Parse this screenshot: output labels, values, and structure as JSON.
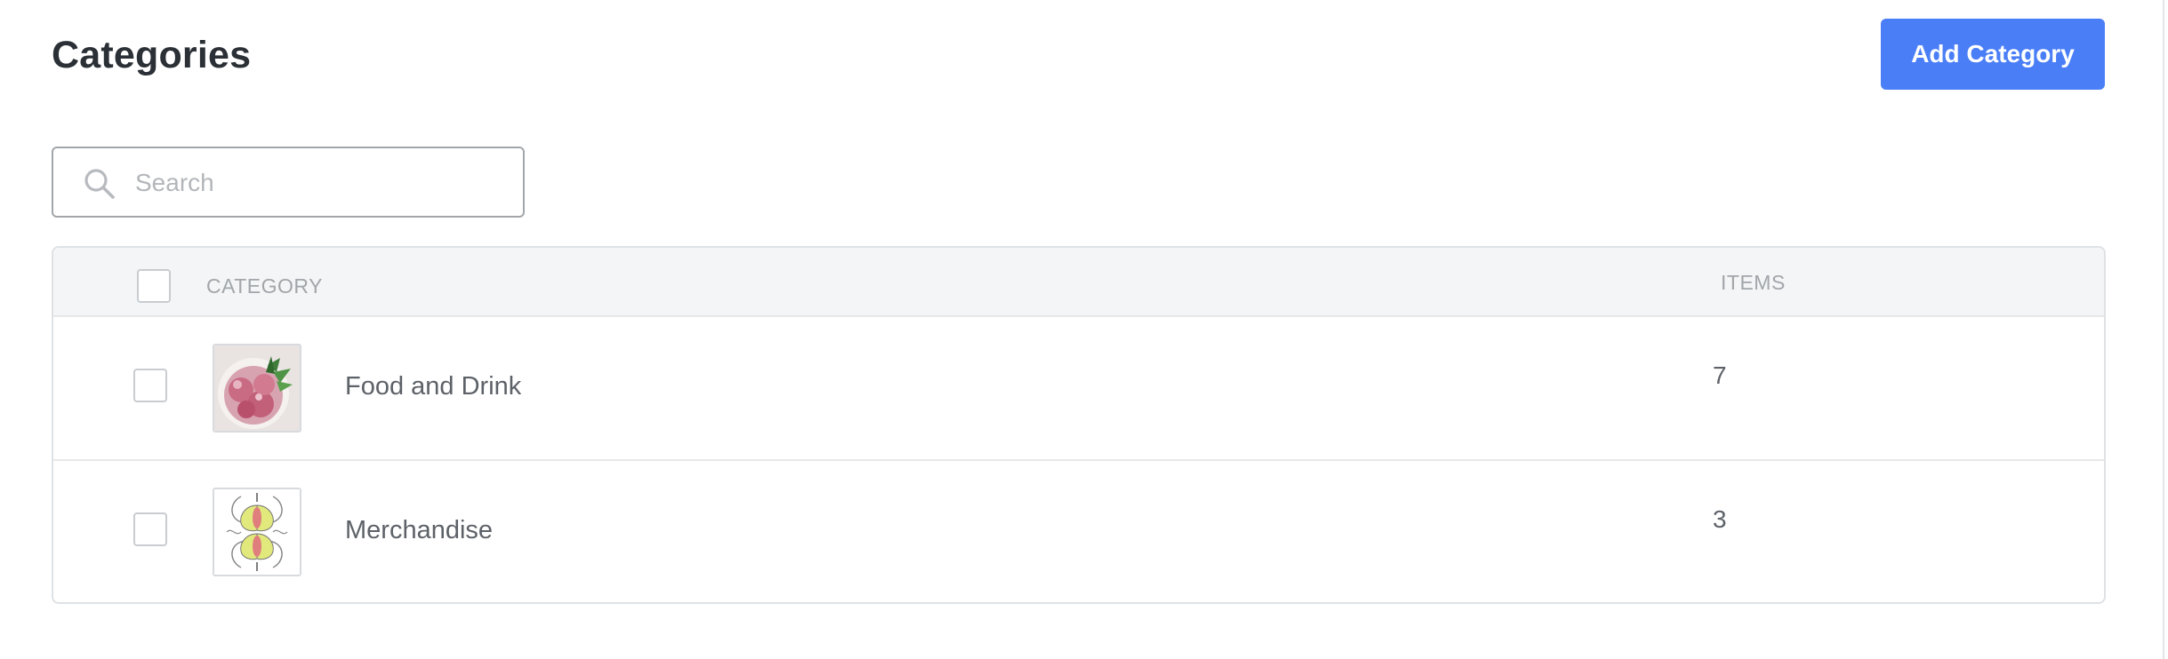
{
  "header": {
    "title": "Categories",
    "add_button_label": "Add Category",
    "accent_color": "#4a7ef7"
  },
  "search": {
    "placeholder": "Search",
    "value": ""
  },
  "table": {
    "columns": [
      "CATEGORY",
      "ITEMS"
    ],
    "rows": [
      {
        "name": "Food and Drink",
        "items": "7",
        "thumbnail": "sorbet-photo"
      },
      {
        "name": "Merchandise",
        "items": "3",
        "thumbnail": "pear-pattern"
      }
    ]
  }
}
